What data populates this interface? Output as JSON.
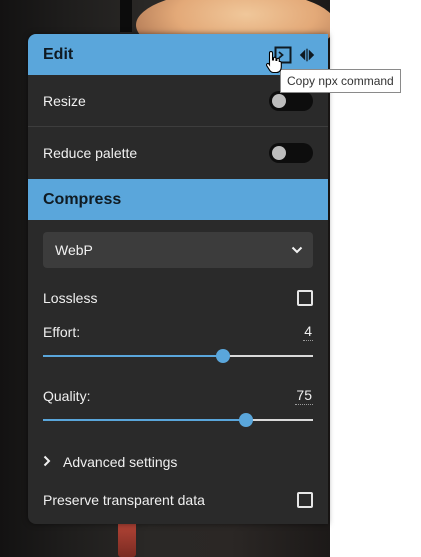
{
  "edit": {
    "title": "Edit",
    "tools": [
      {
        "icon": "terminal-icon"
      },
      {
        "icon": "split-view-arrows-icon"
      }
    ],
    "rows": [
      {
        "label": "Resize",
        "enabled": false
      },
      {
        "label": "Reduce palette",
        "enabled": false
      }
    ]
  },
  "compress": {
    "title": "Compress",
    "format": {
      "selected": "WebP",
      "icon": "chevron-down-icon"
    },
    "lossless": {
      "label": "Lossless",
      "checked": false
    },
    "effort": {
      "label": "Effort:",
      "value": "4",
      "min": 0,
      "max": 6,
      "level": 0.667
    },
    "quality": {
      "label": "Quality:",
      "value": "75",
      "min": 0,
      "max": 100,
      "level": 0.75
    },
    "advanced": {
      "label": "Advanced settings",
      "icon": "chevron-right-icon"
    },
    "preserve": {
      "label": "Preserve transparent data",
      "checked": false
    }
  },
  "tooltip": {
    "text": "Copy npx command"
  },
  "colors": {
    "accent": "#5aa6db",
    "panel": "#2a2a2a",
    "field": "#3c3c3c"
  }
}
